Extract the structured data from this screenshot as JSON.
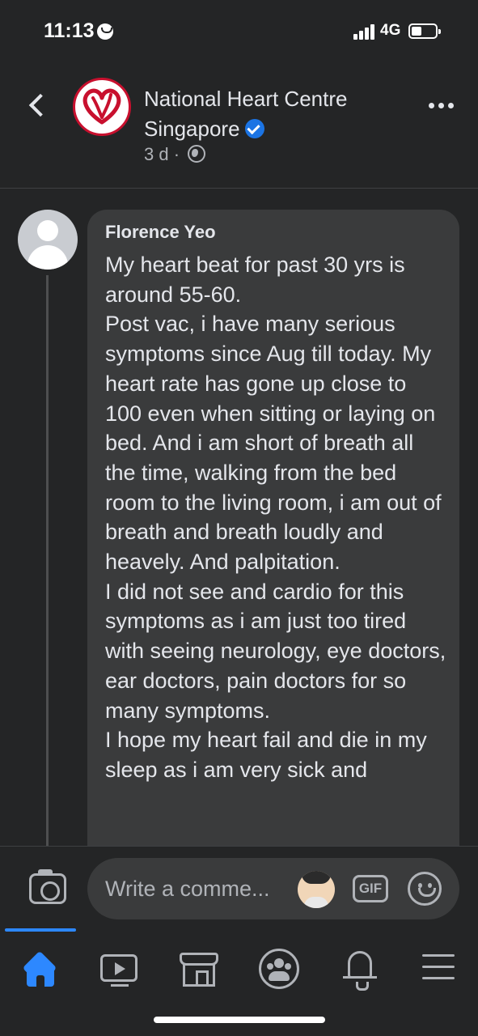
{
  "status_bar": {
    "time": "11:13",
    "network": "4G"
  },
  "header": {
    "page_name": "National Heart Centre Singapore",
    "post_age": "3 d",
    "separator": "·",
    "verified": true
  },
  "comment": {
    "author": "Florence Yeo",
    "lines": [
      "My heart beat for past 30 yrs is around 55-60.",
      "Post vac, i have many serious symptoms since Aug till today. My heart rate has gone up close to 100 even when sitting or laying on bed. And i am short of breath all the time, walking from the bed room to the living room, i am out of breath and breath loudly and heavely. And palpitation.",
      "I did not see and cardio for this symptoms as i am just too tired with seeing neurology, eye doctors, ear doctors, pain doctors for so many symptoms.",
      "I hope my heart fail and die in my sleep as i am very sick and"
    ]
  },
  "composer": {
    "placeholder": "Write a comme...",
    "gif_label": "GIF"
  },
  "tabs": [
    {
      "name": "home",
      "icon": "home-icon",
      "active": true
    },
    {
      "name": "watch",
      "icon": "video-icon",
      "active": false
    },
    {
      "name": "marketplace",
      "icon": "marketplace-icon",
      "active": false
    },
    {
      "name": "groups",
      "icon": "groups-icon",
      "active": false
    },
    {
      "name": "notifications",
      "icon": "bell-icon",
      "active": false
    },
    {
      "name": "menu",
      "icon": "menu-icon",
      "active": false
    }
  ],
  "colors": {
    "background": "#242526",
    "bubble": "#3a3b3c",
    "accent": "#2d88ff",
    "brand_red": "#c8102e"
  }
}
